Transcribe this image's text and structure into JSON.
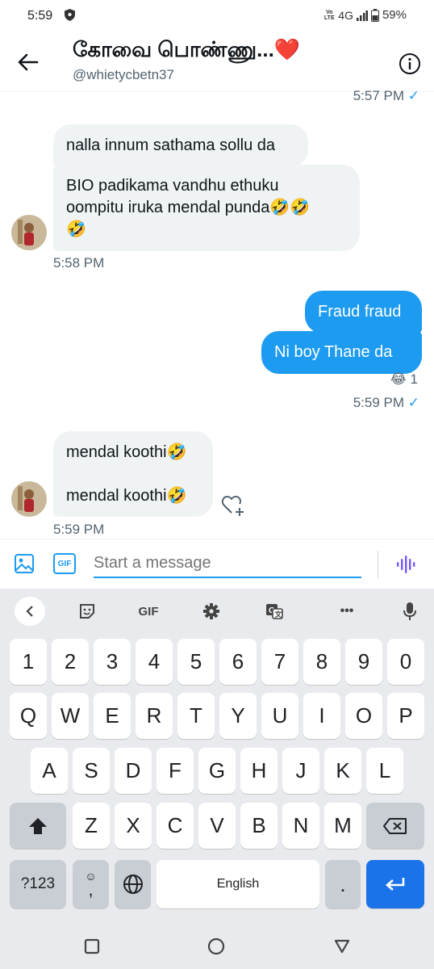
{
  "status_bar": {
    "time": "5:59",
    "network": "4G",
    "battery": "59%",
    "volte": "Vo LTE"
  },
  "header": {
    "title": "கோவை பொண்ணு...❤️",
    "handle": "@whietycbetn37"
  },
  "messages": {
    "top_ts": "5:57 PM",
    "check": "✓",
    "in1_l1": "nalla innum sathama sollu da",
    "in2_l1": "BIO padikama vandhu ethuku",
    "in2_l2": "oompitu iruka mendal punda🤣🤣",
    "in2_l3": "🤣",
    "in_ts1": "5:58 PM",
    "out1": "Fraud fraud",
    "out2": "Ni boy Thane da",
    "reaction_emoji": "😂",
    "reaction_count": "1",
    "out_ts": "5:59 PM",
    "in3_l1": "mendal koothi🤣",
    "in3_l2": "mendal koothi🤣",
    "in_ts2": "5:59 PM"
  },
  "composer": {
    "placeholder": "Start a message",
    "gif_label": "GIF"
  },
  "keyboard": {
    "toolbar": {
      "gif": "GIF",
      "more": "•••"
    },
    "row_numbers": [
      "1",
      "2",
      "3",
      "4",
      "5",
      "6",
      "7",
      "8",
      "9",
      "0"
    ],
    "row1": [
      "Q",
      "W",
      "E",
      "R",
      "T",
      "Y",
      "U",
      "I",
      "O",
      "P"
    ],
    "row2": [
      "A",
      "S",
      "D",
      "F",
      "G",
      "H",
      "J",
      "K",
      "L"
    ],
    "row3": [
      "Z",
      "X",
      "C",
      "V",
      "B",
      "N",
      "M"
    ],
    "symbols": "?123",
    "emoji_key": "☺",
    "comma": ",",
    "space": "English",
    "period": "."
  }
}
